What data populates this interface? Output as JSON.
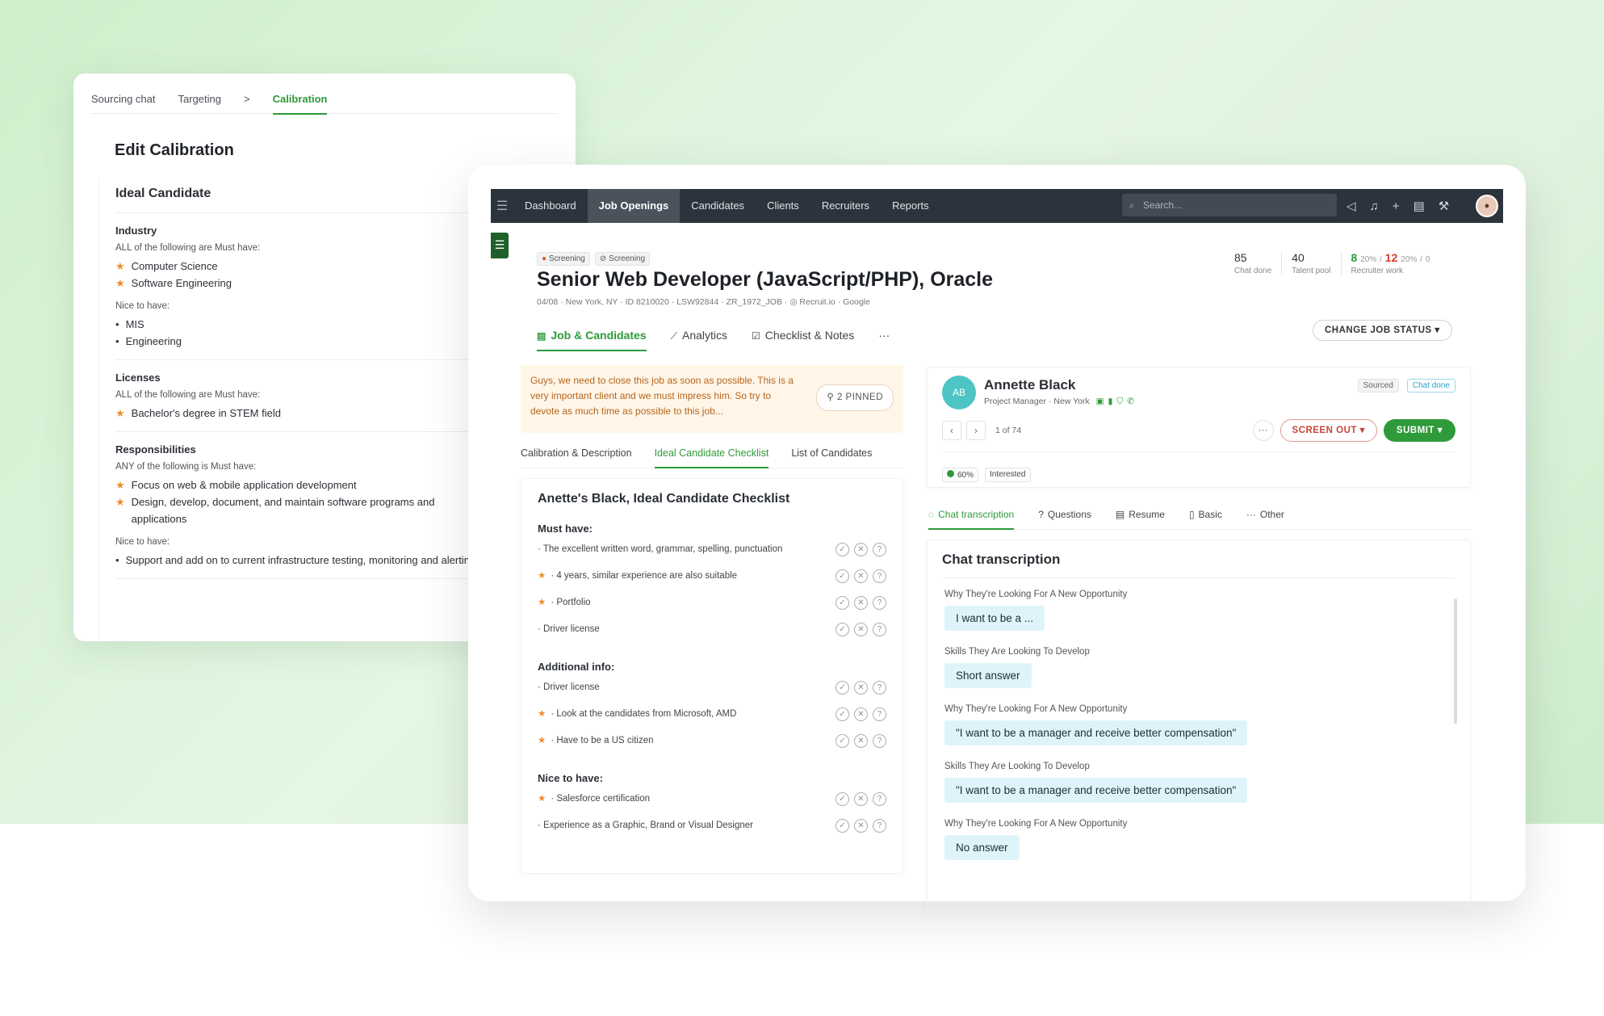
{
  "calibration": {
    "tabs": [
      "Sourcing chat",
      "Targeting",
      "Calibration"
    ],
    "breadcrumb_sep": ">",
    "title": "Edit Calibration",
    "section_title": "Ideal Candidate",
    "industry": {
      "title": "Industry",
      "must_note": "ALL of the following are Must have:",
      "must": [
        "Computer Science",
        "Software Engineering"
      ],
      "nice_note": "Nice to have:",
      "nice": [
        "MIS",
        "Engineering"
      ]
    },
    "licenses": {
      "title": "Licenses",
      "must_note": "ALL of the following are Must have:",
      "must": [
        "Bachelor's degree in STEM field"
      ]
    },
    "responsibilities": {
      "title": "Responsibilities",
      "must_note": "ANY of the following is Must have:",
      "must": [
        "Focus on web & mobile application development",
        "Design, develop, document, and maintain software programs and applications"
      ],
      "nice_note": "Nice to have:",
      "nice": [
        "Support and add on to current infrastructure testing, monitoring and alerting"
      ]
    }
  },
  "nav": {
    "items": [
      "Dashboard",
      "Job Openings",
      "Candidates",
      "Clients",
      "Recruiters",
      "Reports"
    ],
    "active": "Job Openings",
    "search_placeholder": "Search...",
    "tools": [
      "megaphone-icon",
      "bell-icon",
      "plus-icon",
      "document-icon",
      "wrench-icon"
    ]
  },
  "job": {
    "chips": [
      "Screening",
      "Screening"
    ],
    "title": "Senior Web Developer (JavaScript/PHP), Oracle",
    "meta": {
      "date": "04/08",
      "location": "New York, NY",
      "id": "8210020",
      "code1": "LSW92844",
      "code2": "ZR_1972_JOB",
      "source": "Recruit.io",
      "engine": "Google"
    },
    "stats": {
      "chat_done": "85",
      "chat_done_label": "Chat done",
      "talent_pool": "40",
      "talent_pool_label": "Talent pool",
      "rec_green": "8",
      "rec_green_pct": "20%",
      "rec_red": "12",
      "rec_red_pct": "20%",
      "rec_zero": "0",
      "rec_label": "Recruiter work"
    },
    "tabs": [
      "Job & Candidates",
      "Analytics",
      "Checklist & Notes"
    ],
    "more": "···",
    "change_status": "CHANGE JOB STATUS"
  },
  "pinned": {
    "text": "Guys, we need to close this job as soon as possible. This is a very important client and we must impress him. So try to devote as much time as possible to this job...",
    "button": "2 PINNED"
  },
  "left_tabs": [
    "Calibration & Description",
    "Ideal Candidate Checklist",
    "List of Candidates"
  ],
  "checklist": {
    "title": "Anette's Black, Ideal Candidate Checklist",
    "groups": [
      {
        "title": "Must have:",
        "items": [
          {
            "text": "· The excellent written word, grammar, spelling, punctuation",
            "star": false
          },
          {
            "text": "· 4 years, similar experience are also suitable",
            "star": true
          },
          {
            "text": "· Portfolio",
            "star": true
          },
          {
            "text": "· Driver license",
            "star": false
          }
        ]
      },
      {
        "title": "Additional info:",
        "items": [
          {
            "text": "· Driver license",
            "star": false
          },
          {
            "text": "· Look at the candidates from Microsoft, AMD",
            "star": true
          },
          {
            "text": "· Have to be a US citizen",
            "star": true
          }
        ]
      },
      {
        "title": "Nice to have:",
        "items": [
          {
            "text": "· Salesforce certification",
            "star": true
          },
          {
            "text": "· Experience as a Graphic, Brand or Visual Designer",
            "star": false
          }
        ]
      }
    ]
  },
  "candidate": {
    "initials": "AB",
    "name": "Annette Black",
    "role": "Project Manager",
    "city": "New York",
    "badge_sourced": "Sourced",
    "badge_chat": "Chat done",
    "pager": "1 of 74",
    "screen_out": "SCREEN OUT",
    "submit": "SUBMIT",
    "score": "60%",
    "status": "Interested"
  },
  "right_tabs": [
    "Chat transcription",
    "Questions",
    "Resume",
    "Basic",
    "Other"
  ],
  "chat": {
    "title": "Chat transcription",
    "items": [
      {
        "q": "Why They're Looking For A New Opportunity",
        "a": "I want to be a ..."
      },
      {
        "q": "Skills They Are Looking To Develop",
        "a": "Short answer"
      },
      {
        "q": "Why They're Looking For A New Opportunity",
        "a": "\"I want to be a manager and receive better compensation\""
      },
      {
        "q": "Skills They Are Looking To Develop",
        "a": "\"I want to be a manager and receive better compensation\""
      },
      {
        "q": "Why They're Looking For A New Opportunity",
        "a": "No answer"
      }
    ]
  }
}
